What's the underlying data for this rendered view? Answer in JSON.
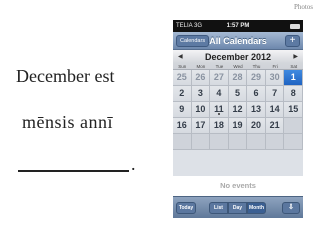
{
  "slide": {
    "line1": "December est",
    "line2": "mēnsis annī",
    "period": ".",
    "credit": "Photos"
  },
  "phone": {
    "status": {
      "carrier": "TELIA 3G",
      "time": "1:57 PM"
    },
    "nav": {
      "back_label": "Calendars",
      "title": "All Calendars",
      "add_label": "+"
    },
    "month": {
      "prev_arrow": "◀",
      "title": "December 2012",
      "next_arrow": "▶"
    },
    "weekdays": [
      "Sun",
      "Mon",
      "Tue",
      "Wed",
      "Thu",
      "Fri",
      "Sat"
    ],
    "days": [
      {
        "label": "25",
        "state": "out"
      },
      {
        "label": "26",
        "state": "out"
      },
      {
        "label": "27",
        "state": "out"
      },
      {
        "label": "28",
        "state": "out"
      },
      {
        "label": "29",
        "state": "out"
      },
      {
        "label": "30",
        "state": "out"
      },
      {
        "label": "1",
        "state": "today"
      },
      {
        "label": "2",
        "state": "in"
      },
      {
        "label": "3",
        "state": "in"
      },
      {
        "label": "4",
        "state": "in"
      },
      {
        "label": "5",
        "state": "in"
      },
      {
        "label": "6",
        "state": "in"
      },
      {
        "label": "7",
        "state": "in"
      },
      {
        "label": "8",
        "state": "in"
      },
      {
        "label": "9",
        "state": "in"
      },
      {
        "label": "10",
        "state": "in"
      },
      {
        "label": "11",
        "state": "in",
        "event": true
      },
      {
        "label": "12",
        "state": "in"
      },
      {
        "label": "13",
        "state": "in"
      },
      {
        "label": "14",
        "state": "in"
      },
      {
        "label": "15",
        "state": "in"
      },
      {
        "label": "16",
        "state": "in"
      },
      {
        "label": "17",
        "state": "in"
      },
      {
        "label": "18",
        "state": "in"
      },
      {
        "label": "19",
        "state": "in"
      },
      {
        "label": "20",
        "state": "in"
      },
      {
        "label": "21",
        "state": "in"
      },
      {
        "label": "",
        "state": "empty"
      },
      {
        "label": "",
        "state": "empty"
      },
      {
        "label": "",
        "state": "empty"
      },
      {
        "label": "",
        "state": "empty"
      },
      {
        "label": "",
        "state": "empty"
      },
      {
        "label": "",
        "state": "empty"
      },
      {
        "label": "",
        "state": "empty"
      },
      {
        "label": "",
        "state": "empty"
      }
    ],
    "events_text": "No events",
    "toolbar": {
      "today": "Today",
      "list": "List",
      "day": "Day",
      "month": "Month",
      "active_view": "month",
      "share_glyph": "⇩"
    },
    "colors": {
      "today_blue": "#1f63c2",
      "nav_blue": "#6d88ad"
    }
  }
}
